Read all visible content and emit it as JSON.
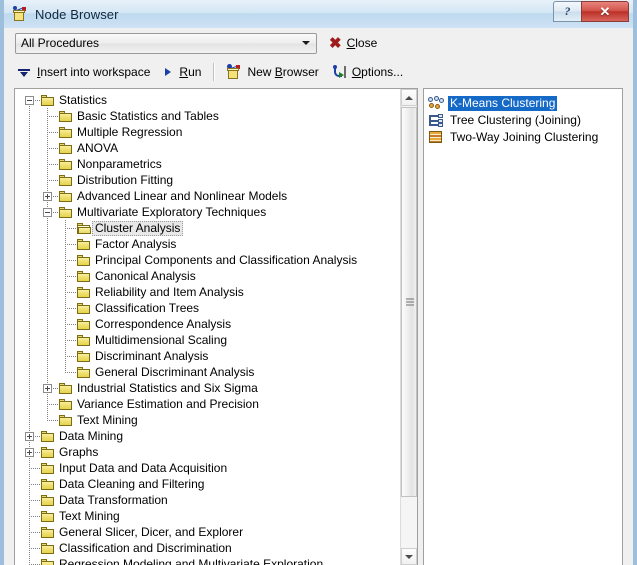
{
  "window": {
    "title": "Node Browser",
    "title_icon": "node-browser-icon",
    "help_button": "?",
    "close_button": "✕",
    "accent_close_color": "#bb3128",
    "titlebar_color": "#bed9ef",
    "selection_color": "#1569c7"
  },
  "filter_bar": {
    "combo": {
      "value": "All Procedures",
      "arrow_icon": "chevron-down-icon"
    },
    "close": {
      "icon": "close-x-icon",
      "label_pre": "",
      "label_accel": "C",
      "label_post": "lose"
    }
  },
  "toolbar": {
    "items": [
      {
        "name": "insert-into-workspace",
        "icon": "insert-down-arrow-icon",
        "pre": "",
        "accel": "I",
        "post": "nsert into workspace"
      },
      {
        "name": "run",
        "icon": "run-triangle-icon",
        "pre": "",
        "accel": "R",
        "post": "un"
      },
      {
        "name": "new-browser",
        "icon": "new-browser-icon",
        "pre": "New ",
        "accel": "B",
        "post": "rowser"
      },
      {
        "name": "options",
        "icon": "options-icon",
        "pre": "",
        "accel": "O",
        "post": "ptions..."
      }
    ]
  },
  "tree": {
    "nodes": [
      {
        "label": "Statistics",
        "depth": 0,
        "expander": "minus",
        "icon": "folder-icon",
        "selected": false
      },
      {
        "label": "Basic Statistics and Tables",
        "depth": 1,
        "expander": "none",
        "icon": "folder-icon",
        "selected": false
      },
      {
        "label": "Multiple Regression",
        "depth": 1,
        "expander": "none",
        "icon": "folder-icon",
        "selected": false
      },
      {
        "label": "ANOVA",
        "depth": 1,
        "expander": "none",
        "icon": "folder-icon",
        "selected": false
      },
      {
        "label": "Nonparametrics",
        "depth": 1,
        "expander": "none",
        "icon": "folder-icon",
        "selected": false
      },
      {
        "label": "Distribution Fitting",
        "depth": 1,
        "expander": "none",
        "icon": "folder-icon",
        "selected": false
      },
      {
        "label": "Advanced Linear and Nonlinear Models",
        "depth": 1,
        "expander": "plus",
        "icon": "folder-icon",
        "selected": false
      },
      {
        "label": "Multivariate Exploratory Techniques",
        "depth": 1,
        "expander": "minus",
        "icon": "folder-icon",
        "selected": false
      },
      {
        "label": "Cluster Analysis",
        "depth": 2,
        "expander": "none",
        "icon": "folder-open-icon",
        "selected": true
      },
      {
        "label": "Factor Analysis",
        "depth": 2,
        "expander": "none",
        "icon": "folder-icon",
        "selected": false
      },
      {
        "label": "Principal Components and Classification Analysis",
        "depth": 2,
        "expander": "none",
        "icon": "folder-icon",
        "selected": false
      },
      {
        "label": "Canonical Analysis",
        "depth": 2,
        "expander": "none",
        "icon": "folder-icon",
        "selected": false
      },
      {
        "label": "Reliability and Item Analysis",
        "depth": 2,
        "expander": "none",
        "icon": "folder-icon",
        "selected": false
      },
      {
        "label": "Classification Trees",
        "depth": 2,
        "expander": "none",
        "icon": "folder-icon",
        "selected": false
      },
      {
        "label": "Correspondence Analysis",
        "depth": 2,
        "expander": "none",
        "icon": "folder-icon",
        "selected": false
      },
      {
        "label": "Multidimensional Scaling",
        "depth": 2,
        "expander": "none",
        "icon": "folder-icon",
        "selected": false
      },
      {
        "label": "Discriminant Analysis",
        "depth": 2,
        "expander": "none",
        "icon": "folder-icon",
        "selected": false
      },
      {
        "label": "General Discriminant Analysis",
        "depth": 2,
        "expander": "none",
        "icon": "folder-icon",
        "selected": false
      },
      {
        "label": "Industrial Statistics and Six Sigma",
        "depth": 1,
        "expander": "plus",
        "icon": "folder-icon",
        "selected": false
      },
      {
        "label": "Variance Estimation and Precision",
        "depth": 1,
        "expander": "none",
        "icon": "folder-icon",
        "selected": false
      },
      {
        "label": "Text Mining",
        "depth": 1,
        "expander": "none",
        "icon": "folder-icon",
        "selected": false
      },
      {
        "label": "Data Mining",
        "depth": 0,
        "expander": "plus",
        "icon": "folder-icon",
        "selected": false
      },
      {
        "label": "Graphs",
        "depth": 0,
        "expander": "plus",
        "icon": "folder-icon",
        "selected": false
      },
      {
        "label": "Input Data and Data Acquisition",
        "depth": 0,
        "expander": "none",
        "icon": "folder-icon",
        "selected": false
      },
      {
        "label": "Data Cleaning and Filtering",
        "depth": 0,
        "expander": "none",
        "icon": "folder-icon",
        "selected": false
      },
      {
        "label": "Data Transformation",
        "depth": 0,
        "expander": "none",
        "icon": "folder-icon",
        "selected": false
      },
      {
        "label": "Text Mining",
        "depth": 0,
        "expander": "none",
        "icon": "folder-icon",
        "selected": false
      },
      {
        "label": "General Slicer, Dicer, and Explorer",
        "depth": 0,
        "expander": "none",
        "icon": "folder-icon",
        "selected": false
      },
      {
        "label": "Classification and Discrimination",
        "depth": 0,
        "expander": "none",
        "icon": "folder-icon",
        "selected": false
      },
      {
        "label": "Regression Modeling and Multivariate Exploration",
        "depth": 0,
        "expander": "none",
        "icon": "folder-icon",
        "selected": false
      }
    ]
  },
  "scrollbar": {
    "up_arrow": "scroll-up-icon",
    "down_arrow": "scroll-down-icon",
    "thumb": "scrollbar-thumb"
  },
  "node_list": {
    "items": [
      {
        "label": "K-Means Clustering",
        "icon": "kmeans-clustering-icon",
        "selected": true
      },
      {
        "label": "Tree Clustering (Joining)",
        "icon": "tree-clustering-icon",
        "selected": false
      },
      {
        "label": "Two-Way Joining Clustering",
        "icon": "two-way-joining-icon",
        "selected": false
      }
    ]
  }
}
